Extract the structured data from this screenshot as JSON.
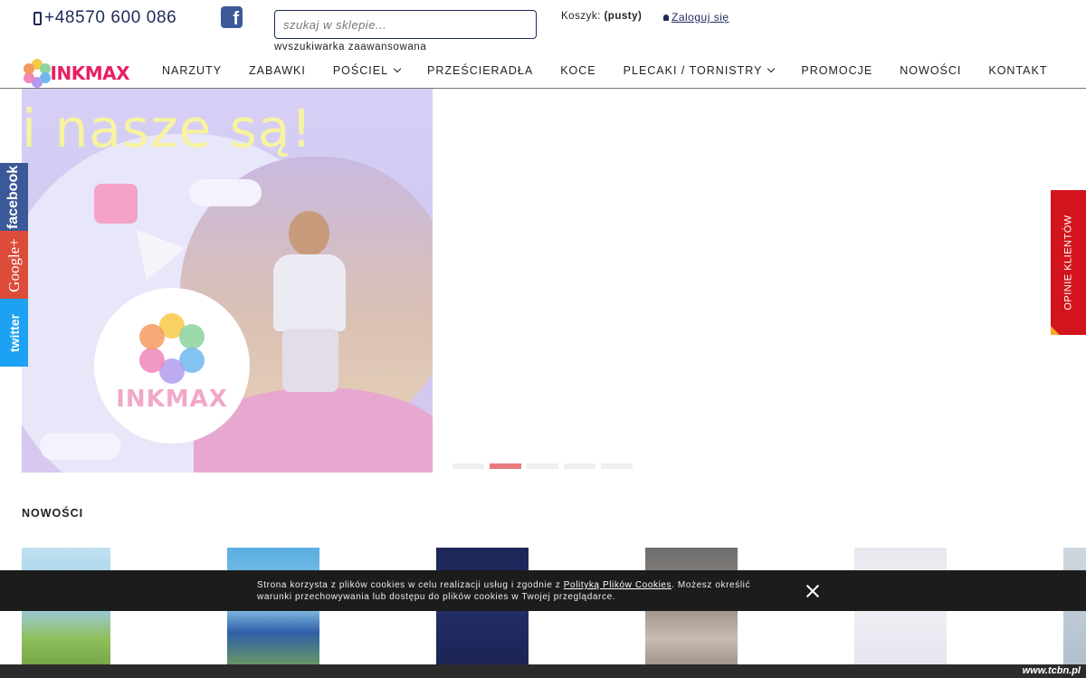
{
  "header": {
    "phone": "+48570 600 086",
    "search_placeholder": "szukaj w sklepie...",
    "advanced_search": "wvszukiwarka zaawansowana",
    "cart_label": "Koszyk:",
    "cart_status": "(pusty)",
    "login": "Zaloguj się"
  },
  "logo": {
    "text": "INKMAX"
  },
  "nav": {
    "items": [
      "NARZUTY",
      "ZABAWKI",
      "POŚCIEL",
      "PRZEŚCIERADŁA",
      "KOCE",
      "PLECAKI / TORNISTRY",
      "PROMOCJE",
      "NOWOŚCI",
      "KONTAKT"
    ]
  },
  "banner": {
    "headline": "i nasze są!",
    "brand": "INKMAX",
    "active_slide": 2,
    "slide_count": 5
  },
  "social": {
    "facebook": "facebook",
    "google": "Google+",
    "twitter": "twitter"
  },
  "opinions": "OPINIE KLIENTÓW",
  "section": {
    "title": "NOWOŚCI"
  },
  "cookie": {
    "text_before": "Strona korzysta z plików cookies w celu realizacji usług i zgodnie z ",
    "link": "Polityką Plików Cookies",
    "text_after": ". Możesz określić warunki przechowywania lub dostępu do plików cookies w Twojej przeglądarce."
  },
  "watermark": "www.tcbn.pl",
  "colors": {
    "accent": "#e87a7e",
    "navy": "#1d2a5a",
    "opinions": "#d2151d"
  }
}
